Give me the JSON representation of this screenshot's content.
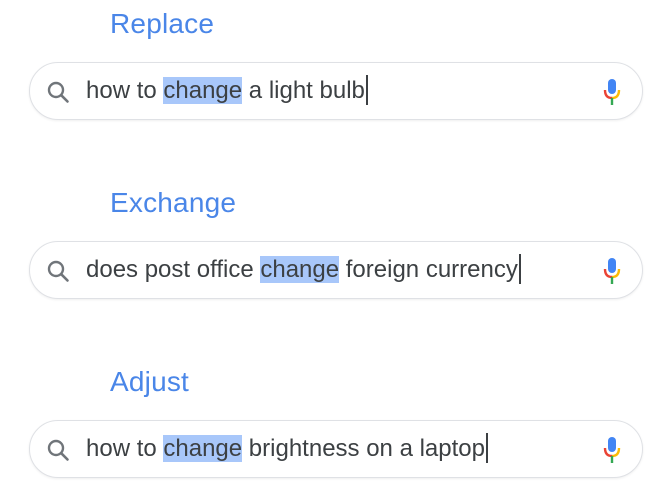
{
  "examples": [
    {
      "label": "Replace",
      "query_before": "how to ",
      "query_highlight": "change",
      "query_after": " a light bulb"
    },
    {
      "label": "Exchange",
      "query_before": "does post office ",
      "query_highlight": "change",
      "query_after": " foreign currency"
    },
    {
      "label": "Adjust",
      "query_before": "how to ",
      "query_highlight": "change",
      "query_after": " brightness on a laptop"
    }
  ],
  "icons": {
    "search": "search-icon",
    "mic": "microphone-icon"
  },
  "colors": {
    "label": "#4a86e8",
    "highlight": "#a8c7fa",
    "text": "#3c4043",
    "border": "#dfe1e5",
    "mic_blue": "#4285f4",
    "mic_red": "#ea4335",
    "mic_yellow": "#fbbc05",
    "mic_green": "#34a853"
  }
}
